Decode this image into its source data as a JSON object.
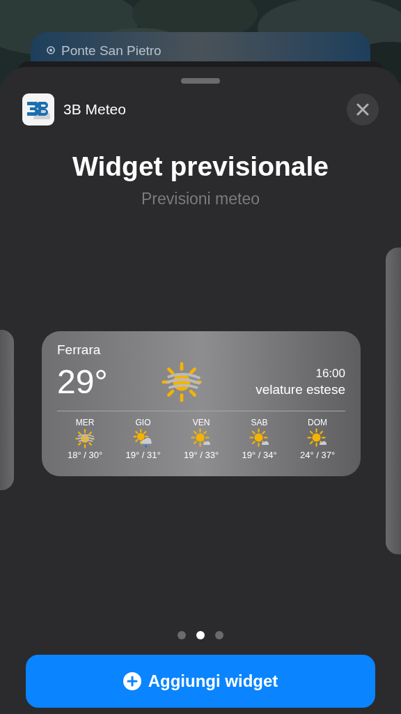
{
  "background_card": {
    "location": "Ponte San Pietro"
  },
  "sheet": {
    "app_name": "3B Meteo",
    "title": "Widget previsionale",
    "subtitle": "Previsioni meteo"
  },
  "widget": {
    "city": "Ferrara",
    "temperature": "29°",
    "time": "16:00",
    "condition": "velature estese",
    "current_icon": {
      "kind": "hazy"
    },
    "forecast": [
      {
        "day": "MER",
        "kind": "hazy",
        "range": "18° / 30°"
      },
      {
        "day": "GIO",
        "kind": "sun-rain",
        "range": "19° / 31°"
      },
      {
        "day": "VEN",
        "kind": "sun-cloud",
        "range": "19° / 33°"
      },
      {
        "day": "SAB",
        "kind": "sun-cloud",
        "range": "19° / 34°"
      },
      {
        "day": "DOM",
        "kind": "sun-cloud",
        "range": "24° / 37°"
      }
    ]
  },
  "page_dots": [
    {
      "selected": false
    },
    {
      "selected": true
    },
    {
      "selected": false
    }
  ],
  "add_button": {
    "label": "Aggiungi widget"
  }
}
